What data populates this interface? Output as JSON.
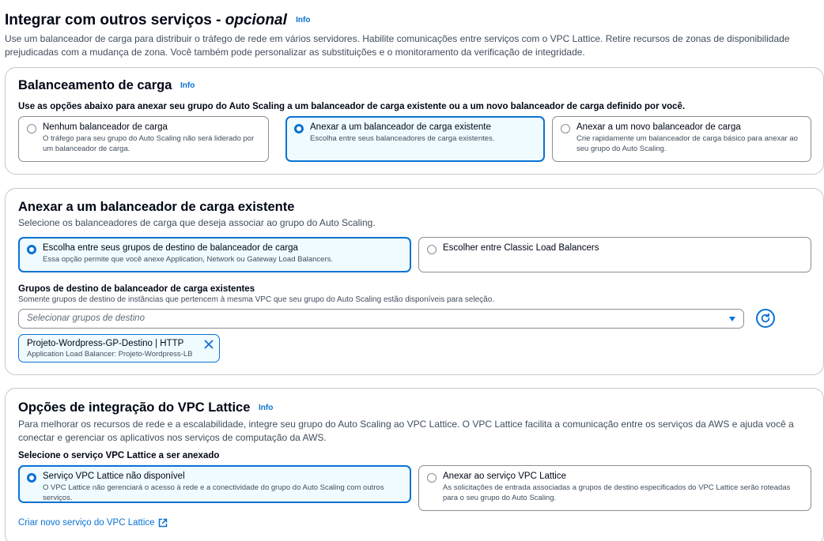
{
  "header": {
    "title": "Integrar com outros serviços - ",
    "title_optional": "opcional",
    "info": "Info",
    "description": "Use um balanceador de carga para distribuir o tráfego de rede em vários servidores. Habilite comunicações entre serviços com o VPC Lattice. Retire recursos de zonas de disponibilidade prejudicadas com a mudança de zona. Você também pode personalizar as substituições e o monitoramento da verificação de integridade."
  },
  "load_balancing": {
    "title": "Balanceamento de carga",
    "info": "Info",
    "instruction": "Use as opções abaixo para anexar seu grupo do Auto Scaling a um balanceador de carga existente ou a um novo balanceador de carga definido por você.",
    "options": [
      {
        "label": "Nenhum balanceador de carga",
        "description": "O tráfego para seu grupo do Auto Scaling não será liderado por um balanceador de carga."
      },
      {
        "label": "Anexar a um balanceador de carga existente",
        "description": "Escolha entre seus balanceadores de carga existentes."
      },
      {
        "label": "Anexar a um novo balanceador de carga",
        "description": "Crie rapidamente um balanceador de carga básico para anexar ao seu grupo do Auto Scaling."
      }
    ],
    "selected_index": 1
  },
  "attach_existing": {
    "title": "Anexar a um balanceador de carga existente",
    "description": "Selecione os balanceadores de carga que deseja associar ao grupo do Auto Scaling.",
    "options": [
      {
        "label": "Escolha entre seus grupos de destino de balanceador de carga",
        "description": "Essa opção permite que você anexe Application, Network ou Gateway Load Balancers."
      },
      {
        "label": "Escolher entre Classic Load Balancers",
        "description": ""
      }
    ],
    "selected_index": 0,
    "target_groups_label": "Grupos de destino de balanceador de carga existentes",
    "target_groups_desc": "Somente grupos de destino de instâncias que pertencem à mesma VPC que seu grupo do Auto Scaling estão disponíveis para seleção.",
    "select_placeholder": "Selecionar grupos de destino",
    "token": {
      "label": "Projeto-Wordpress-GP-Destino | HTTP",
      "sublabel": "Application Load Balancer: Projeto-Wordpress-LB"
    }
  },
  "vpc_lattice": {
    "title": "Opções de integração do VPC Lattice",
    "info": "Info",
    "description": "Para melhorar os recursos de rede e a escalabilidade, integre seu grupo do Auto Scaling ao VPC Lattice. O VPC Lattice facilita a comunicação entre os serviços da AWS e ajuda você a conectar e gerenciar os aplicativos nos serviços de computação da AWS.",
    "select_label": "Selecione o serviço VPC Lattice a ser anexado",
    "options": [
      {
        "label": "Serviço VPC Lattice não disponível",
        "description": "O VPC Lattice não gerenciará o acesso à rede e a conectividade do grupo do Auto Scaling com outros serviços."
      },
      {
        "label": "Anexar ao serviço VPC Lattice",
        "description": "As solicitações de entrada associadas a grupos de destino especificados do VPC Lattice serão roteadas para o seu grupo do Auto Scaling."
      }
    ],
    "selected_index": 0,
    "create_link": "Criar novo serviço do VPC Lattice"
  },
  "colors": {
    "accent": "#0972d3",
    "selected_bg": "#f0fbff",
    "border": "#8c8c94",
    "text": "#000716",
    "muted_text": "#414d5c"
  },
  "icons": [
    "info-link",
    "radio-icon",
    "caret-down-icon",
    "refresh-icon",
    "close-icon",
    "external-link-icon"
  ]
}
